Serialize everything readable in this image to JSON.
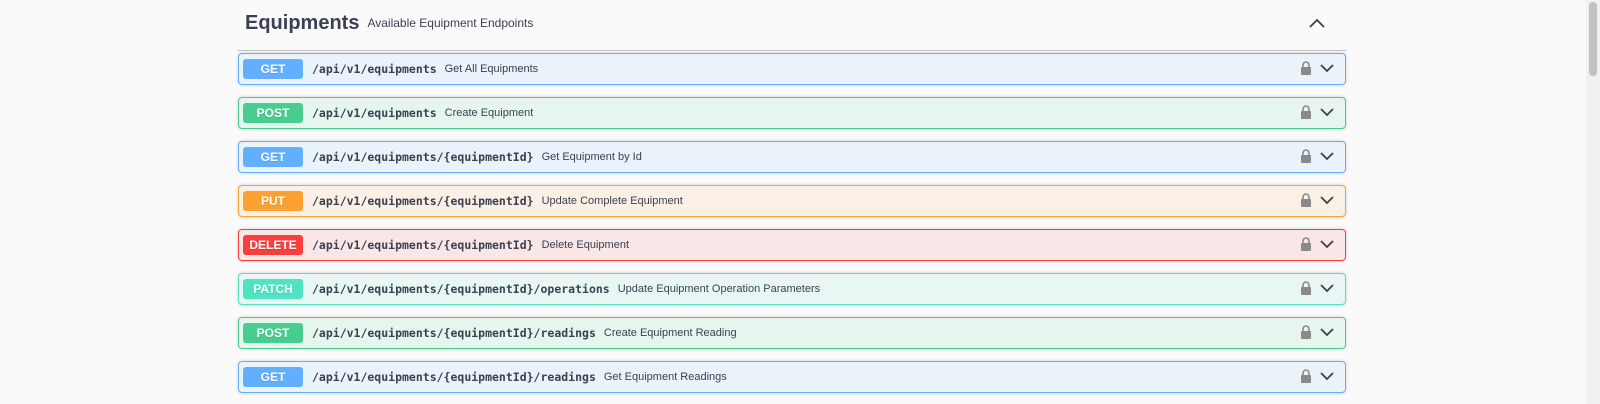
{
  "tag": {
    "title": "Equipments",
    "description": "Available Equipment Endpoints"
  },
  "icons": {
    "collapse": "chevron-up-icon",
    "lock": "lock-icon",
    "expand": "chevron-down-icon"
  },
  "colors": {
    "get": "#61affe",
    "post": "#49cc90",
    "put": "#fca130",
    "delete": "#f93e3e",
    "patch": "#50e3c2"
  },
  "operations": [
    {
      "method": "GET",
      "path": "/api/v1/equipments",
      "summary": "Get All Equipments"
    },
    {
      "method": "POST",
      "path": "/api/v1/equipments",
      "summary": "Create Equipment"
    },
    {
      "method": "GET",
      "path": "/api/v1/equipments/{equipmentId}",
      "summary": "Get Equipment by Id"
    },
    {
      "method": "PUT",
      "path": "/api/v1/equipments/{equipmentId}",
      "summary": "Update Complete Equipment"
    },
    {
      "method": "DELETE",
      "path": "/api/v1/equipments/{equipmentId}",
      "summary": "Delete Equipment"
    },
    {
      "method": "PATCH",
      "path": "/api/v1/equipments/{equipmentId}/operations",
      "summary": "Update Equipment Operation Parameters"
    },
    {
      "method": "POST",
      "path": "/api/v1/equipments/{equipmentId}/readings",
      "summary": "Create Equipment Reading"
    },
    {
      "method": "GET",
      "path": "/api/v1/equipments/{equipmentId}/readings",
      "summary": "Get Equipment Readings"
    }
  ]
}
